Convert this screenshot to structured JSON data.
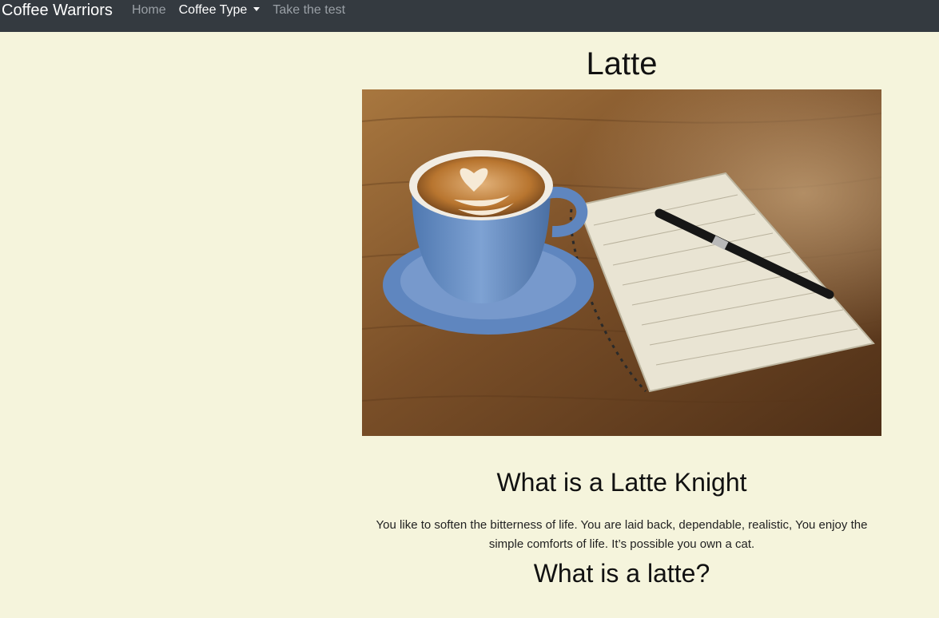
{
  "navbar": {
    "brand": "Coffee Warriors",
    "links": [
      {
        "label": "Home"
      },
      {
        "label": "Coffee Type"
      },
      {
        "label": "Take the test"
      }
    ],
    "colors": {
      "bar": "#343a40",
      "link": "#9aa0a6",
      "active": "#ffffff"
    }
  },
  "page": {
    "title": "Latte",
    "image_subject": "coffee-cup-with-notebook-and-pen",
    "section1_heading": "What is a Latte Knight",
    "section1_text": "You like to soften the bitterness of life. You are laid back, dependable, realistic, You enjoy the simple comforts of life. It’s possible you own a cat.",
    "section2_heading": "What is a latte?",
    "background": "#f5f4dc"
  }
}
